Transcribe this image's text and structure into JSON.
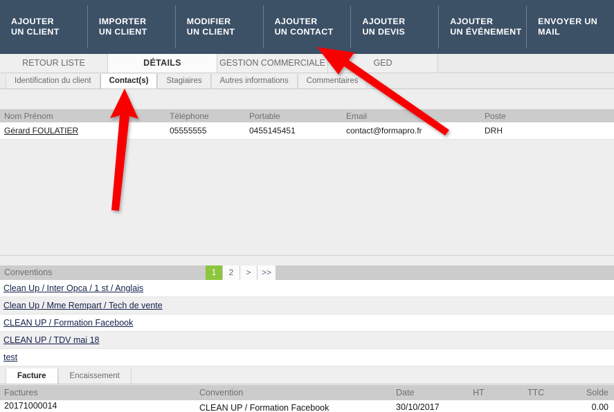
{
  "topnav": {
    "items": [
      {
        "line1": "AJOUTER",
        "line2": "UN CLIENT"
      },
      {
        "line1": "IMPORTER",
        "line2": "UN CLIENT"
      },
      {
        "line1": "MODIFIER",
        "line2": "UN CLIENT"
      },
      {
        "line1": "AJOUTER",
        "line2": "UN CONTACT"
      },
      {
        "line1": "AJOUTER",
        "line2": "UN DEVIS"
      },
      {
        "line1": "AJOUTER",
        "line2": "UN ÉVÉNEMENT"
      },
      {
        "line1": "ENVOYER UN",
        "line2": "MAIL"
      }
    ],
    "background": "#3c5066"
  },
  "main_tabs": [
    {
      "label": "RETOUR LISTE",
      "active": false
    },
    {
      "label": "DÉTAILS",
      "active": true
    },
    {
      "label": "GESTION COMMERCIALE",
      "active": false
    },
    {
      "label": "GED",
      "active": false
    }
  ],
  "sub_tabs": [
    {
      "label": "Identification du client",
      "active": false
    },
    {
      "label": "Contact(s)",
      "active": true
    },
    {
      "label": "Stagiaires",
      "active": false
    },
    {
      "label": "Autres informations",
      "active": false
    },
    {
      "label": "Commentaires",
      "active": false
    }
  ],
  "contacts": {
    "headers": {
      "nom": "Nom Prénom",
      "telephone": "Téléphone",
      "portable": "Portable",
      "email": "Email",
      "poste": "Poste"
    },
    "rows": [
      {
        "nom": "Gérard FOULATIER",
        "telephone": "05555555",
        "portable": "0455145451",
        "email": "contact@formapro.fr",
        "poste": "DRH"
      }
    ]
  },
  "conventions": {
    "title": "Conventions",
    "pager": [
      {
        "label": "1",
        "active": true
      },
      {
        "label": "2",
        "active": false
      },
      {
        "label": ">",
        "active": false
      },
      {
        "label": ">>",
        "active": false
      }
    ],
    "active_color": "#8cc63e",
    "items": [
      "Clean Up / Inter Opca / 1 st / Anglais",
      "Clean Up / Mme Rempart / Tech de vente",
      "CLEAN UP / Formation Facebook",
      "CLEAN UP / TDV mai 18",
      "test"
    ]
  },
  "factures": {
    "tabs": [
      {
        "label": "Facture",
        "active": true
      },
      {
        "label": "Encaissement",
        "active": false
      }
    ],
    "headers": {
      "numero": "Factures",
      "convention": "Convention",
      "date": "Date",
      "ht": "HT",
      "ttc": "TTC",
      "solde": "Solde"
    },
    "rows": [
      {
        "numero": "20171000014",
        "convention": "CLEAN UP / Formation Facebook",
        "date": "30/10/2017",
        "ht": "",
        "ttc": "",
        "solde": "0.00"
      }
    ]
  },
  "annotations": {
    "color": "#f90000",
    "arrows": [
      {
        "name": "arrow-to-contacts-tab"
      },
      {
        "name": "arrow-to-add-contact"
      }
    ]
  }
}
